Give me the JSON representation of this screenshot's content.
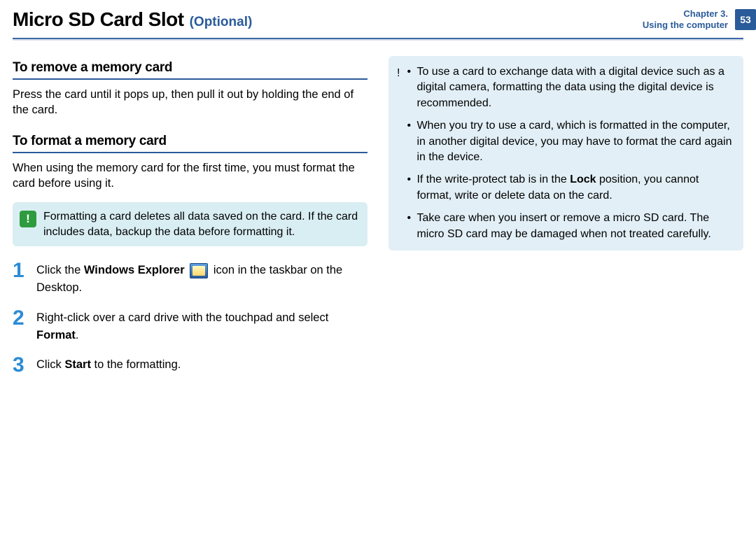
{
  "header": {
    "title": "Micro SD Card Slot",
    "optional": "(Optional)",
    "chapter_line1": "Chapter 3.",
    "chapter_line2": "Using the computer",
    "page": "53"
  },
  "left": {
    "sec1_title": "To remove a memory card",
    "sec1_body": "Press the card until it pops up, then pull it out by holding the end of the card.",
    "sec2_title": "To format a memory card",
    "sec2_body": "When using the memory card for the first time, you must format the card before using it.",
    "callout": "Formatting a card deletes all data saved on the card. If the card includes data, backup the data before formatting it.",
    "steps": {
      "s1_a": "Click the ",
      "s1_bold": "Windows Explorer",
      "s1_b": " icon in the taskbar on the Desktop.",
      "s2_a": "Right-click over a card drive with the touchpad and select ",
      "s2_bold": "Format",
      "s2_b": ".",
      "s3_a": "Click ",
      "s3_bold": "Start",
      "s3_b": " to the formatting."
    }
  },
  "right": {
    "items": [
      "To use a card to exchange data with a digital device such as a digital camera, formatting the data using the digital device is recommended.",
      "When you try to use a card, which is formatted in the computer, in another digital device, you may have to format the card again in the device.",
      "",
      "Take care when you insert or remove a micro SD card. The micro SD card may be damaged when not treated carefully."
    ],
    "item3_a": "If the write-protect tab is in the ",
    "item3_bold": "Lock",
    "item3_b": " position, you cannot format, write or delete data on the card."
  }
}
